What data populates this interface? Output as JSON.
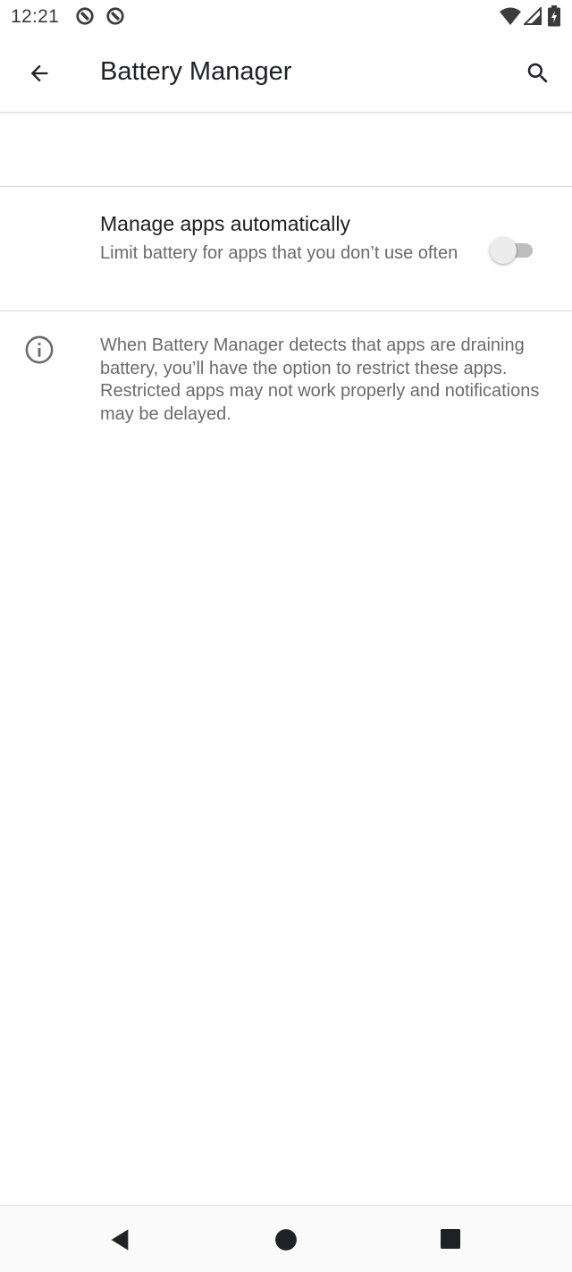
{
  "status_bar": {
    "time": "12:21",
    "icons": [
      "notification-icon",
      "notification-icon",
      "wifi-icon",
      "signal-icon",
      "battery-icon"
    ]
  },
  "app_bar": {
    "title": "Battery Manager",
    "back_icon": "back-arrow-icon",
    "search_icon": "search-icon"
  },
  "setting": {
    "title": "Manage apps automatically",
    "summary": "Limit battery for apps that you don’t use often",
    "toggle_on": false
  },
  "footer": {
    "icon": "info-icon",
    "text": "When Battery Manager detects that apps are draining battery, you’ll have the option to restrict these apps. Restricted apps may not work properly and notifications may be delayed."
  },
  "nav_bar": {
    "icons": [
      "nav-back-icon",
      "nav-home-icon",
      "nav-recents-icon"
    ]
  },
  "colors": {
    "text_primary": "#202124",
    "text_secondary": "#6b6b6b",
    "divider": "#d6d6d6",
    "toggle_track_off": "#bdbdbd",
    "toggle_thumb_off": "#ececec"
  }
}
